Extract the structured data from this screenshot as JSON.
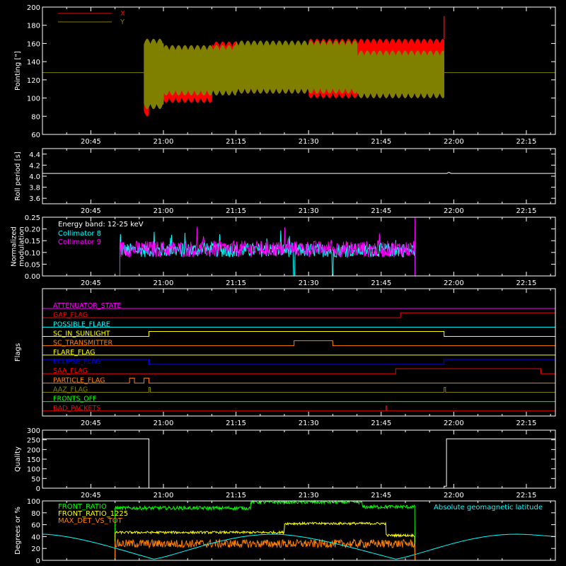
{
  "chart_data": [
    {
      "id": "pointing",
      "type": "line",
      "ylabel": "Pointing [\"]",
      "ylim": [
        60,
        200
      ],
      "yticks": [
        60,
        80,
        100,
        120,
        140,
        160,
        180,
        200
      ],
      "x_ticks": [
        "20:45",
        "21:00",
        "21:15",
        "21:30",
        "21:45",
        "22:00",
        "22:15"
      ],
      "x_range": [
        "20:35",
        "22:21"
      ],
      "legend": {
        "placement": "top-left"
      },
      "series": [
        {
          "name": "X",
          "color": "#ff0000",
          "segments": [
            {
              "from": "20:56",
              "to": "20:57",
              "min": 80,
              "max": 165
            },
            {
              "from": "20:57",
              "to": "21:10",
              "min": 95,
              "max": 158
            },
            {
              "from": "21:10",
              "to": "21:30",
              "min": 105,
              "max": 162
            },
            {
              "from": "21:30",
              "to": "21:58",
              "min": 100,
              "max": 165
            }
          ],
          "end_spike": {
            "time": "21:58",
            "value": 190
          }
        },
        {
          "name": "Y",
          "color": "#808000",
          "segments": [
            {
              "from": "20:56",
              "to": "21:00",
              "min": 88,
              "max": 165
            },
            {
              "from": "21:00",
              "to": "21:15",
              "min": 103,
              "max": 158
            },
            {
              "from": "21:15",
              "to": "21:40",
              "min": 105,
              "max": 163
            },
            {
              "from": "21:40",
              "to": "21:58",
              "min": 100,
              "max": 152
            }
          ],
          "baseline": 128
        }
      ]
    },
    {
      "id": "roll",
      "type": "line",
      "ylabel": "Roll period [s]",
      "ylim": [
        3.5,
        4.5
      ],
      "yticks": [
        3.6,
        3.8,
        4.0,
        4.2,
        4.4
      ],
      "x_ticks": [
        "20:45",
        "21:00",
        "21:15",
        "21:30",
        "21:45",
        "22:00",
        "22:15"
      ],
      "series": [
        {
          "color": "#ffffff",
          "value": 4.05,
          "from": "20:35",
          "to": "22:21",
          "bump": {
            "time": "21:59",
            "value": 4.07
          }
        }
      ]
    },
    {
      "id": "modulation",
      "type": "line",
      "ylabel": [
        "Normalized",
        "modulation"
      ],
      "ylim": [
        0,
        0.25
      ],
      "yticks": [
        0.0,
        0.05,
        0.1,
        0.15,
        0.2,
        0.25
      ],
      "x_ticks": [
        "20:45",
        "21:00",
        "21:15",
        "21:30",
        "21:45",
        "22:00",
        "22:15"
      ],
      "legend": {
        "placement": "top-left",
        "title": "Energy band: 12-25 keV"
      },
      "series": [
        {
          "name": "Collimator 8",
          "color": "#00ffff",
          "from": "20:51",
          "to": "21:52",
          "mean": 0.11,
          "noise": 0.03,
          "gaps": [
            [
              "21:27",
              "21:35"
            ]
          ]
        },
        {
          "name": "Collimator 9",
          "color": "#ff00ff",
          "from": "20:51",
          "to": "21:52",
          "mean": 0.115,
          "noise": 0.035,
          "end_spike": {
            "time": "21:52",
            "value": 0.25
          }
        }
      ]
    },
    {
      "id": "flags",
      "type": "line",
      "ylabel": "Flags",
      "x_ticks": [
        "20:45",
        "21:00",
        "21:15",
        "21:30",
        "21:45",
        "22:00",
        "22:15"
      ],
      "rows": [
        {
          "name": "ATTENUATOR_STATE",
          "color": "#ff00ff",
          "transitions": []
        },
        {
          "name": "GAP_FLAG",
          "color": "#ff0000",
          "transitions": [
            [
              "21:49",
              1
            ]
          ]
        },
        {
          "name": "POSSIBLE_FLARE",
          "color": "#00ffff",
          "transitions": []
        },
        {
          "name": "SC_IN_SUNLIGHT",
          "color": "#ffff00",
          "transitions": [
            [
              "20:57",
              1
            ],
            [
              "21:58",
              0
            ]
          ]
        },
        {
          "name": "SC_TRANSMITTER",
          "color": "#ff8000",
          "transitions": [
            [
              "21:27",
              1
            ],
            [
              "21:35",
              0
            ]
          ]
        },
        {
          "name": "FLARE_FLAG",
          "color": "#ffff00",
          "transitions": []
        },
        {
          "name": "ECLIPSE_FLAG",
          "color": "#0000ff",
          "transitions": [
            [
              "20:57",
              0
            ],
            [
              "21:58",
              1
            ]
          ]
        },
        {
          "name": "SAA_FLAG",
          "color": "#ff0000",
          "transitions": [
            [
              "21:48",
              1
            ],
            [
              "22:18",
              0
            ]
          ]
        },
        {
          "name": "PARTICLE_FLAG",
          "color": "#ff8000",
          "pulses": [
            [
              "20:53",
              "20:54"
            ],
            [
              "20:56",
              "20:57"
            ]
          ]
        },
        {
          "name": "AAZ_FLAG",
          "color": "#808000",
          "pulses": [
            [
              "20:57",
              "20:57.3"
            ],
            [
              "21:58",
              "21:58.3"
            ]
          ]
        },
        {
          "name": "FRONTS_OFF",
          "color": "#00ff00",
          "transitions": []
        },
        {
          "name": "BAD_PACKETS",
          "color": "#ff0000",
          "pulses": [
            [
              "21:46",
              "21:46.2"
            ]
          ]
        }
      ]
    },
    {
      "id": "quality",
      "type": "line",
      "ylabel": "Quality",
      "ylim": [
        0,
        300
      ],
      "yticks": [
        0,
        50,
        100,
        150,
        200,
        250,
        300
      ],
      "x_ticks": [
        "20:45",
        "21:00",
        "21:15",
        "21:30",
        "21:45",
        "22:00",
        "22:15"
      ],
      "series": [
        {
          "color": "#ffffff",
          "steps": [
            [
              "20:35",
              255
            ],
            [
              "20:57",
              0
            ],
            [
              "21:58",
              10
            ],
            [
              "21:58.5",
              255
            ],
            [
              "22:21",
              255
            ]
          ]
        }
      ]
    },
    {
      "id": "ratios",
      "type": "line",
      "ylabel": "Degrees or %",
      "ylim": [
        0,
        100
      ],
      "yticks": [
        0,
        20,
        40,
        60,
        80,
        100
      ],
      "legend": {
        "placement": "top-left"
      },
      "annotation": {
        "text": "Absolute geomagnetic latitude",
        "color": "#00ffff",
        "placement": "top-right"
      },
      "series": [
        {
          "name": "FRONT_RATIO",
          "color": "#00ff00",
          "from": "20:50",
          "to": "21:52",
          "levels": [
            [
              "20:50",
              88
            ],
            [
              "21:18",
              98
            ],
            [
              "21:41",
              90
            ]
          ],
          "noise": 3
        },
        {
          "name": "FRONT_RATIO_1225",
          "color": "#ffff00",
          "from": "20:50",
          "to": "21:52",
          "levels": [
            [
              "20:50",
              47
            ],
            [
              "21:25",
              62
            ],
            [
              "21:46",
              42
            ]
          ],
          "noise": 2
        },
        {
          "name": "MAX_DET_VS_TOT",
          "color": "#ff8000",
          "from": "20:50",
          "to": "21:52",
          "levels": [
            [
              "20:50",
              28
            ]
          ],
          "noise": 7
        },
        {
          "name": "Absolute geomagnetic latitude",
          "color": "#00ffff",
          "points": [
            [
              "20:35",
              44
            ],
            [
              "20:58",
              2
            ],
            [
              "21:23",
              44
            ],
            [
              "21:48",
              2
            ],
            [
              "22:13",
              44
            ],
            [
              "22:21",
              40
            ]
          ]
        }
      ]
    }
  ]
}
